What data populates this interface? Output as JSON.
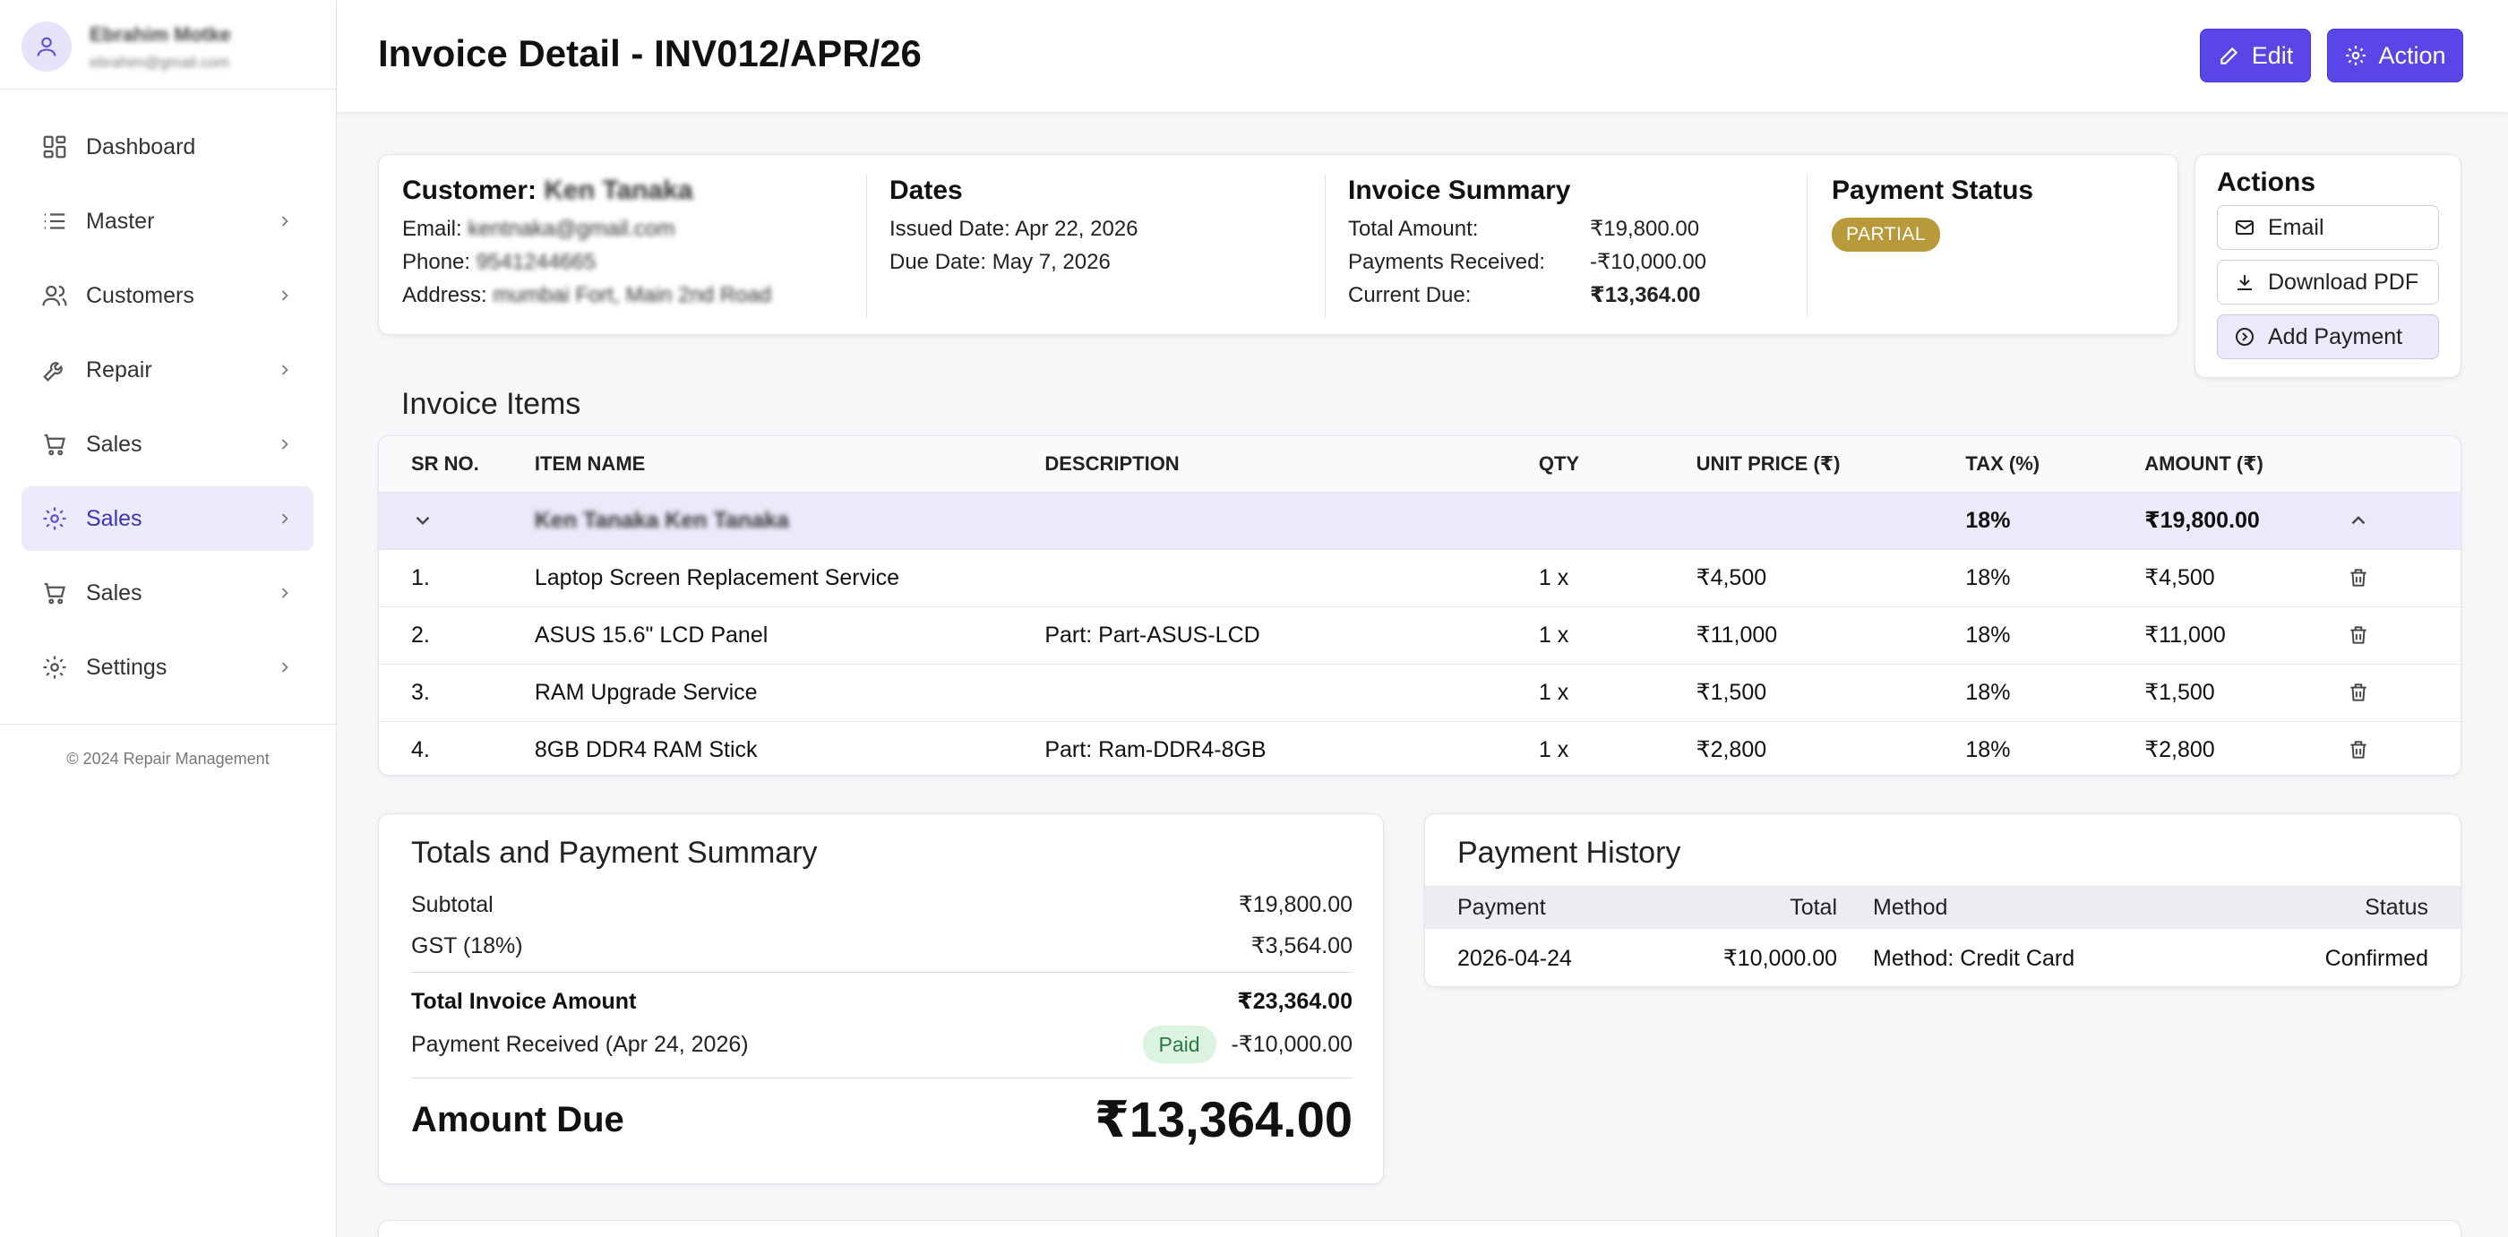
{
  "user": {
    "name": "Ebrahim Motke",
    "email": "ebrahim@gmail.com"
  },
  "sidebar": {
    "items": [
      {
        "label": "Dashboard",
        "icon": "dashboard-icon"
      },
      {
        "label": "Master",
        "icon": "list-icon"
      },
      {
        "label": "Customers",
        "icon": "users-icon"
      },
      {
        "label": "Repair",
        "icon": "wrench-icon"
      },
      {
        "label": "Sales",
        "icon": "cart-icon"
      },
      {
        "label": "Sales",
        "icon": "gear-icon",
        "active": true
      },
      {
        "label": "Sales",
        "icon": "cart-icon"
      },
      {
        "label": "Settings",
        "icon": "gear-icon"
      }
    ],
    "footer": "© 2024 Repair Management"
  },
  "header": {
    "title": "Invoice Detail - INV012/APR/26",
    "edit_label": "Edit",
    "action_label": "Action",
    "accent": "#5a45e6"
  },
  "customer": {
    "label": "Customer:",
    "name": "Ken Tanaka",
    "email_label": "Email:",
    "email": "kentnaka@gmail.com",
    "phone_label": "Phone:",
    "phone": "9541244665",
    "address_label": "Address:",
    "address": "mumbai Fort, Main 2nd Road"
  },
  "dates": {
    "title": "Dates",
    "issued": "Issued Date: Apr 22, 2026",
    "due": "Due Date: May 7, 2026"
  },
  "summary": {
    "title": "Invoice Summary",
    "total_label": "Total Amount:",
    "total": "₹19,800.00",
    "received_label": "Payments Received:",
    "received": "-₹10,000.00",
    "due_label": "Current Due:",
    "due": "₹13,364.00"
  },
  "payment_status": {
    "title": "Payment Status",
    "badge": "PARTIAL",
    "badge_color": "#b99a3a"
  },
  "actions": {
    "title": "Actions",
    "email": "Email",
    "download": "Download PDF",
    "add_payment": "Add Payment"
  },
  "items": {
    "title": "Invoice Items",
    "headers": [
      "SR NO.",
      "ITEM NAME",
      "DESCRIPTION",
      "QTY",
      "UNIT PRICE (₹)",
      "TAX (%)",
      "AMOUNT (₹)"
    ],
    "group": {
      "name": "Ken Tanaka Ken Tanaka",
      "tax": "18%",
      "amount": "₹19,800.00"
    },
    "rows": [
      {
        "sr": "1.",
        "name": "Laptop Screen Replacement Service",
        "desc": "",
        "qty": "1 x",
        "price": "₹4,500",
        "tax": "18%",
        "amount": "₹4,500"
      },
      {
        "sr": "2.",
        "name": "ASUS 15.6\" LCD Panel",
        "desc": "Part: Part-ASUS-LCD",
        "qty": "1 x",
        "price": "₹11,000",
        "tax": "18%",
        "amount": "₹11,000"
      },
      {
        "sr": "3.",
        "name": "RAM Upgrade Service",
        "desc": "",
        "qty": "1 x",
        "price": "₹1,500",
        "tax": "18%",
        "amount": "₹1,500"
      },
      {
        "sr": "4.",
        "name": "8GB DDR4 RAM Stick",
        "desc": "Part: Ram-DDR4-8GB",
        "qty": "1 x",
        "price": "₹2,800",
        "tax": "18%",
        "amount": "₹2,800"
      }
    ]
  },
  "totals": {
    "title": "Totals and Payment Summary",
    "subtotal_label": "Subtotal",
    "subtotal": "₹19,800.00",
    "gst_label": "GST (18%)",
    "gst": "₹3,564.00",
    "total_label": "Total Invoice Amount",
    "total": "₹23,364.00",
    "received_label": "Payment Received (Apr 24, 2026)",
    "paid_badge": "Paid",
    "received": "-₹10,000.00",
    "due_label": "Amount Due",
    "due": "₹13,364.00"
  },
  "history": {
    "title": "Payment History",
    "headers": [
      "Payment",
      "Total",
      "Method",
      "Status"
    ],
    "rows": [
      {
        "date": "2026-04-24",
        "total": "₹10,000.00",
        "method": "Method: Credit Card",
        "status": "Confirmed"
      }
    ]
  }
}
